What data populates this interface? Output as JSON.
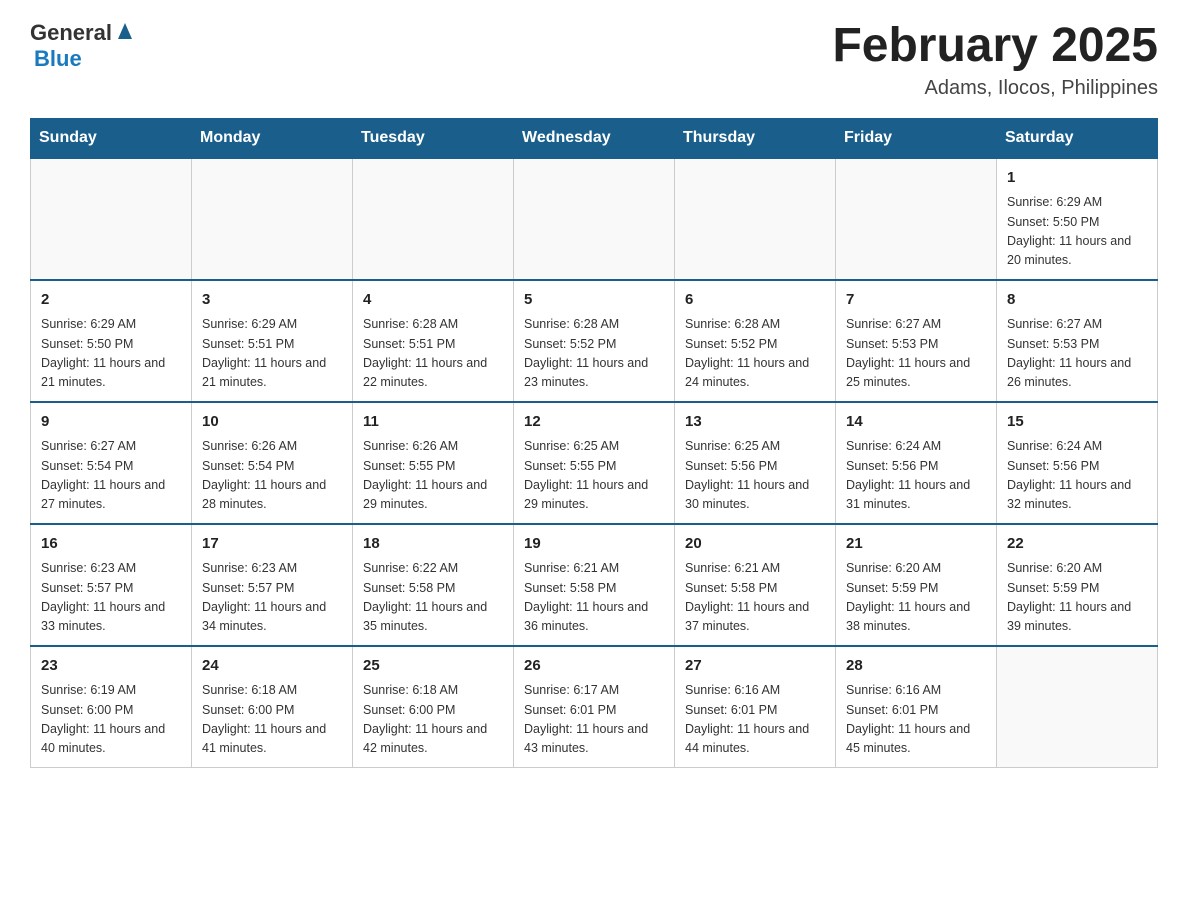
{
  "header": {
    "logo_general": "General",
    "logo_blue": "Blue",
    "title": "February 2025",
    "subtitle": "Adams, Ilocos, Philippines"
  },
  "days_of_week": [
    "Sunday",
    "Monday",
    "Tuesday",
    "Wednesday",
    "Thursday",
    "Friday",
    "Saturday"
  ],
  "weeks": [
    {
      "days": [
        {
          "number": "",
          "sunrise": "",
          "sunset": "",
          "daylight": ""
        },
        {
          "number": "",
          "sunrise": "",
          "sunset": "",
          "daylight": ""
        },
        {
          "number": "",
          "sunrise": "",
          "sunset": "",
          "daylight": ""
        },
        {
          "number": "",
          "sunrise": "",
          "sunset": "",
          "daylight": ""
        },
        {
          "number": "",
          "sunrise": "",
          "sunset": "",
          "daylight": ""
        },
        {
          "number": "",
          "sunrise": "",
          "sunset": "",
          "daylight": ""
        },
        {
          "number": "1",
          "sunrise": "Sunrise: 6:29 AM",
          "sunset": "Sunset: 5:50 PM",
          "daylight": "Daylight: 11 hours and 20 minutes."
        }
      ]
    },
    {
      "days": [
        {
          "number": "2",
          "sunrise": "Sunrise: 6:29 AM",
          "sunset": "Sunset: 5:50 PM",
          "daylight": "Daylight: 11 hours and 21 minutes."
        },
        {
          "number": "3",
          "sunrise": "Sunrise: 6:29 AM",
          "sunset": "Sunset: 5:51 PM",
          "daylight": "Daylight: 11 hours and 21 minutes."
        },
        {
          "number": "4",
          "sunrise": "Sunrise: 6:28 AM",
          "sunset": "Sunset: 5:51 PM",
          "daylight": "Daylight: 11 hours and 22 minutes."
        },
        {
          "number": "5",
          "sunrise": "Sunrise: 6:28 AM",
          "sunset": "Sunset: 5:52 PM",
          "daylight": "Daylight: 11 hours and 23 minutes."
        },
        {
          "number": "6",
          "sunrise": "Sunrise: 6:28 AM",
          "sunset": "Sunset: 5:52 PM",
          "daylight": "Daylight: 11 hours and 24 minutes."
        },
        {
          "number": "7",
          "sunrise": "Sunrise: 6:27 AM",
          "sunset": "Sunset: 5:53 PM",
          "daylight": "Daylight: 11 hours and 25 minutes."
        },
        {
          "number": "8",
          "sunrise": "Sunrise: 6:27 AM",
          "sunset": "Sunset: 5:53 PM",
          "daylight": "Daylight: 11 hours and 26 minutes."
        }
      ]
    },
    {
      "days": [
        {
          "number": "9",
          "sunrise": "Sunrise: 6:27 AM",
          "sunset": "Sunset: 5:54 PM",
          "daylight": "Daylight: 11 hours and 27 minutes."
        },
        {
          "number": "10",
          "sunrise": "Sunrise: 6:26 AM",
          "sunset": "Sunset: 5:54 PM",
          "daylight": "Daylight: 11 hours and 28 minutes."
        },
        {
          "number": "11",
          "sunrise": "Sunrise: 6:26 AM",
          "sunset": "Sunset: 5:55 PM",
          "daylight": "Daylight: 11 hours and 29 minutes."
        },
        {
          "number": "12",
          "sunrise": "Sunrise: 6:25 AM",
          "sunset": "Sunset: 5:55 PM",
          "daylight": "Daylight: 11 hours and 29 minutes."
        },
        {
          "number": "13",
          "sunrise": "Sunrise: 6:25 AM",
          "sunset": "Sunset: 5:56 PM",
          "daylight": "Daylight: 11 hours and 30 minutes."
        },
        {
          "number": "14",
          "sunrise": "Sunrise: 6:24 AM",
          "sunset": "Sunset: 5:56 PM",
          "daylight": "Daylight: 11 hours and 31 minutes."
        },
        {
          "number": "15",
          "sunrise": "Sunrise: 6:24 AM",
          "sunset": "Sunset: 5:56 PM",
          "daylight": "Daylight: 11 hours and 32 minutes."
        }
      ]
    },
    {
      "days": [
        {
          "number": "16",
          "sunrise": "Sunrise: 6:23 AM",
          "sunset": "Sunset: 5:57 PM",
          "daylight": "Daylight: 11 hours and 33 minutes."
        },
        {
          "number": "17",
          "sunrise": "Sunrise: 6:23 AM",
          "sunset": "Sunset: 5:57 PM",
          "daylight": "Daylight: 11 hours and 34 minutes."
        },
        {
          "number": "18",
          "sunrise": "Sunrise: 6:22 AM",
          "sunset": "Sunset: 5:58 PM",
          "daylight": "Daylight: 11 hours and 35 minutes."
        },
        {
          "number": "19",
          "sunrise": "Sunrise: 6:21 AM",
          "sunset": "Sunset: 5:58 PM",
          "daylight": "Daylight: 11 hours and 36 minutes."
        },
        {
          "number": "20",
          "sunrise": "Sunrise: 6:21 AM",
          "sunset": "Sunset: 5:58 PM",
          "daylight": "Daylight: 11 hours and 37 minutes."
        },
        {
          "number": "21",
          "sunrise": "Sunrise: 6:20 AM",
          "sunset": "Sunset: 5:59 PM",
          "daylight": "Daylight: 11 hours and 38 minutes."
        },
        {
          "number": "22",
          "sunrise": "Sunrise: 6:20 AM",
          "sunset": "Sunset: 5:59 PM",
          "daylight": "Daylight: 11 hours and 39 minutes."
        }
      ]
    },
    {
      "days": [
        {
          "number": "23",
          "sunrise": "Sunrise: 6:19 AM",
          "sunset": "Sunset: 6:00 PM",
          "daylight": "Daylight: 11 hours and 40 minutes."
        },
        {
          "number": "24",
          "sunrise": "Sunrise: 6:18 AM",
          "sunset": "Sunset: 6:00 PM",
          "daylight": "Daylight: 11 hours and 41 minutes."
        },
        {
          "number": "25",
          "sunrise": "Sunrise: 6:18 AM",
          "sunset": "Sunset: 6:00 PM",
          "daylight": "Daylight: 11 hours and 42 minutes."
        },
        {
          "number": "26",
          "sunrise": "Sunrise: 6:17 AM",
          "sunset": "Sunset: 6:01 PM",
          "daylight": "Daylight: 11 hours and 43 minutes."
        },
        {
          "number": "27",
          "sunrise": "Sunrise: 6:16 AM",
          "sunset": "Sunset: 6:01 PM",
          "daylight": "Daylight: 11 hours and 44 minutes."
        },
        {
          "number": "28",
          "sunrise": "Sunrise: 6:16 AM",
          "sunset": "Sunset: 6:01 PM",
          "daylight": "Daylight: 11 hours and 45 minutes."
        },
        {
          "number": "",
          "sunrise": "",
          "sunset": "",
          "daylight": ""
        }
      ]
    }
  ]
}
